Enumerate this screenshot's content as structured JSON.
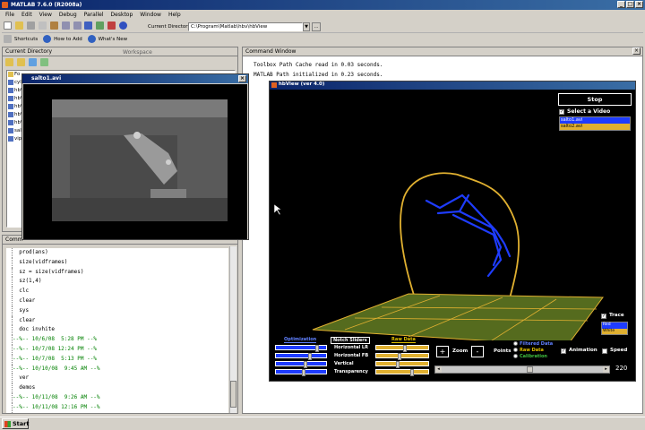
{
  "app": {
    "title": "MATLAB 7.6.0 (R2008a)"
  },
  "menu": [
    "File",
    "Edit",
    "View",
    "Debug",
    "Parallel",
    "Desktop",
    "Window",
    "Help"
  ],
  "toolbar": {
    "current_directory_label": "Current Directory:",
    "current_directory_value": "C:\\Program\\Matlab\\hbv\\hbView",
    "browse_label": "...",
    "shortcuts_label": "Shortcuts",
    "how_to_add_label": "How to Add",
    "whats_new_label": "What's New"
  },
  "current_directory_panel": {
    "title": "Current Directory",
    "tab_workspace": "Workspace",
    "files": [
      "Fo",
      "cyl",
      "hb\\",
      "hb\\",
      "hb\\",
      "hb\\",
      "hb\\",
      "sal",
      "vipu"
    ]
  },
  "video_window": {
    "title": "salto1.avi"
  },
  "command_history": {
    "title": "Comm",
    "lines": [
      {
        "text": "  prod(ans)",
        "color": "#000000"
      },
      {
        "text": "  size(vidframes)",
        "color": "#000000"
      },
      {
        "text": "  sz = size(vidframes)",
        "color": "#000000"
      },
      {
        "text": "  sz(1,4)",
        "color": "#000000"
      },
      {
        "text": "  clc",
        "color": "#000000"
      },
      {
        "text": "  clear",
        "color": "#000000"
      },
      {
        "text": "  sys",
        "color": "#000000"
      },
      {
        "text": "  clear",
        "color": "#000000"
      },
      {
        "text": "  doc invhite",
        "color": "#000000"
      },
      {
        "text": "--%-- 10/6/08  5:28 PM --%",
        "color": "#008000"
      },
      {
        "text": "--%-- 10/7/08 12:24 PM --%",
        "color": "#008000"
      },
      {
        "text": "--%-- 10/7/08  5:13 PM --%",
        "color": "#008000"
      },
      {
        "text": "--%-- 10/10/08  9:45 AM --%",
        "color": "#008000"
      },
      {
        "text": "  ver",
        "color": "#000000"
      },
      {
        "text": "  demos",
        "color": "#000000"
      },
      {
        "text": "--%-- 10/11/08  9:26 AM --%",
        "color": "#008000"
      },
      {
        "text": "--%-- 10/11/08 12:16 PM --%",
        "color": "#008000"
      }
    ]
  },
  "command_window": {
    "title": "Command Window",
    "lines": [
      "Toolbox Path Cache read in 0.03 seconds.",
      "MATLAB Path initialized in 0.23 seconds."
    ]
  },
  "hbview": {
    "title": "hbView (ver 4.0)",
    "stop_label": "Stop",
    "select_video_label": "Select a Video",
    "videos": [
      "salto1.avi",
      "salto2.avi"
    ],
    "trace_label": "Trace",
    "trace_options": [
      "Red",
      "White"
    ],
    "groups": {
      "left": "Optimization",
      "middle": "Notch Sliders",
      "right": "Raw Data"
    },
    "sliders": [
      "Horizontal LR",
      "Horizontal FB",
      "Vertical",
      "Transparency"
    ],
    "zoom_label": "Zoom",
    "zoom_plus": "+",
    "zoom_minus": "-",
    "points_label": "Points",
    "points_options": [
      "Filtered Data",
      "Raw Data",
      "Calibration"
    ],
    "animation_label": "Animation",
    "speed_label": "Speed",
    "frame_value": "220",
    "frame_progress": 0.55
  },
  "taskbar": {
    "start_label": "Start"
  },
  "colors": {
    "title_blue": "#0a246a",
    "stick_figure": "#1e3cff",
    "bubble": "#e0b030",
    "floor": "#556b1e",
    "green_text": "#008000",
    "gold_text": "#e0c000"
  }
}
